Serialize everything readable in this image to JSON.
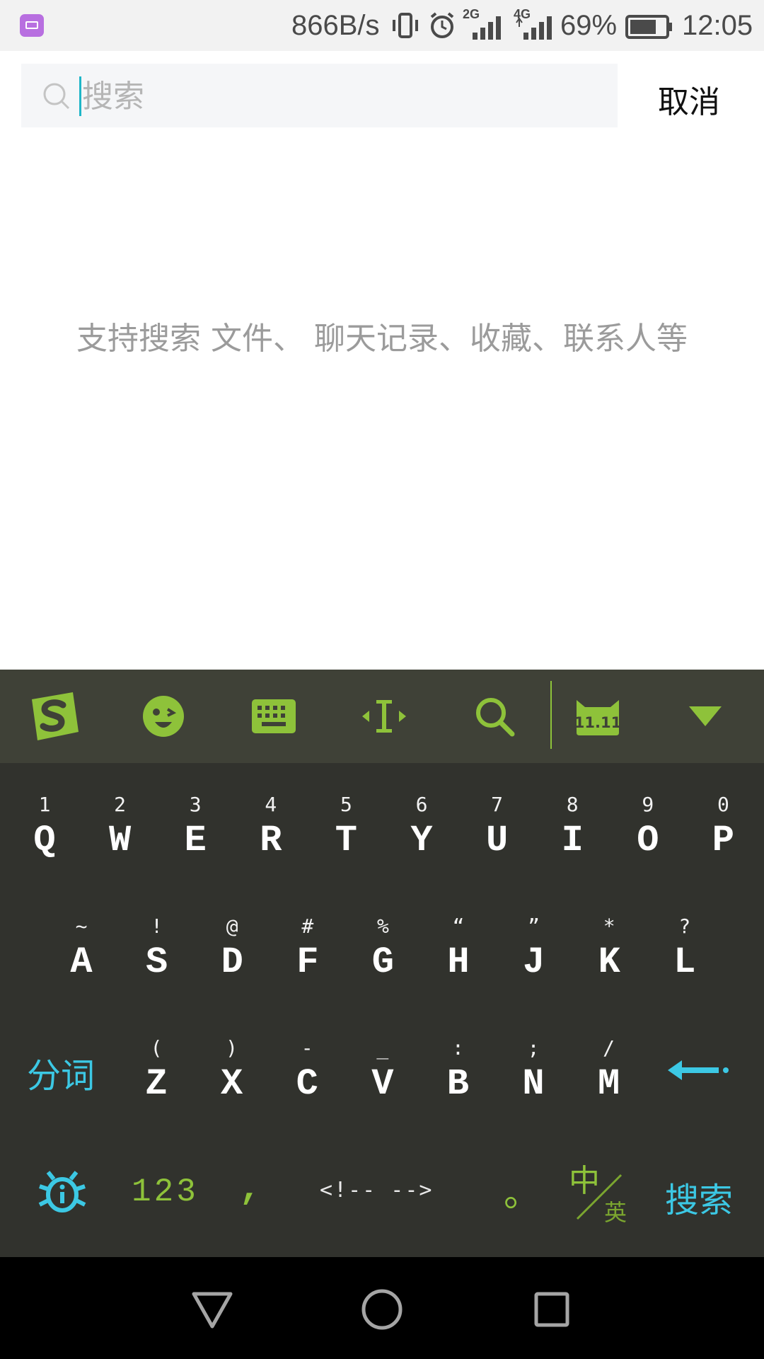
{
  "status_bar": {
    "network_speed": "866B/s",
    "net2": "2G",
    "net4": "4G",
    "battery": "69%",
    "time": "12:05"
  },
  "search": {
    "placeholder": "搜索",
    "value": "",
    "cancel_label": "取消",
    "hint": "支持搜索 文件、 聊天记录、收藏、联系人等"
  },
  "keyboard": {
    "toolbar_icons": [
      "sogou-logo-icon",
      "emoji-icon",
      "keyboard-icon",
      "cursor-move-icon",
      "search-icon",
      "double11-icon",
      "collapse-icon"
    ],
    "rows": [
      [
        {
          "main": "Q",
          "sub": "1"
        },
        {
          "main": "W",
          "sub": "2"
        },
        {
          "main": "E",
          "sub": "3"
        },
        {
          "main": "R",
          "sub": "4"
        },
        {
          "main": "T",
          "sub": "5"
        },
        {
          "main": "Y",
          "sub": "6"
        },
        {
          "main": "U",
          "sub": "7"
        },
        {
          "main": "I",
          "sub": "8"
        },
        {
          "main": "O",
          "sub": "9"
        },
        {
          "main": "P",
          "sub": "0"
        }
      ],
      [
        {
          "main": "A",
          "sub": "~"
        },
        {
          "main": "S",
          "sub": "!"
        },
        {
          "main": "D",
          "sub": "@"
        },
        {
          "main": "F",
          "sub": "#"
        },
        {
          "main": "G",
          "sub": "%"
        },
        {
          "main": "H",
          "sub": "“"
        },
        {
          "main": "J",
          "sub": "”"
        },
        {
          "main": "K",
          "sub": "*"
        },
        {
          "main": "L",
          "sub": "?"
        }
      ],
      [
        {
          "main": "Z",
          "sub": "("
        },
        {
          "main": "X",
          "sub": ")"
        },
        {
          "main": "C",
          "sub": "-"
        },
        {
          "main": "V",
          "sub": "_"
        },
        {
          "main": "B",
          "sub": ":"
        },
        {
          "main": "N",
          "sub": ";"
        },
        {
          "main": "M",
          "sub": "/"
        }
      ]
    ],
    "segment_label": "分词",
    "numbers_label": "123",
    "comma_label": ",",
    "space_label": "<!-- -->",
    "period_label": "。",
    "lang_primary": "中",
    "lang_secondary": "英",
    "search_key_label": "搜索",
    "colors": {
      "accent_green": "#8ec23a",
      "accent_blue": "#3cc8e4",
      "body": "#31322d",
      "toolbar": "#3f4137"
    }
  }
}
